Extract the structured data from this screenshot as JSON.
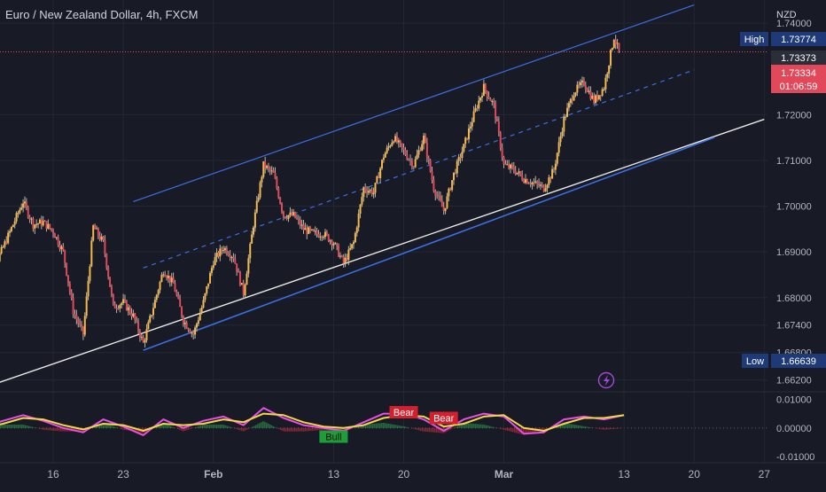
{
  "header": {
    "title": "Euro / New Zealand Dollar, 4h, FXCM"
  },
  "colors": {
    "background": "#181b25",
    "grid": "#232734",
    "candle_up": "#f5b84a",
    "candle_down": "#e1485a",
    "wick": "#b8b3a6",
    "channel": "#3b6fe0",
    "support": "#e8e8e8",
    "price_line": "#e1485a",
    "osc_fast": "#e84fe8",
    "osc_slow": "#f0d64a",
    "hist_up": "#2e9c50",
    "hist_down": "#c4303e",
    "bull": "#1e9d3a",
    "bear": "#d3202f",
    "label_bg": "#1f3a78",
    "accent_icon": "#a04bd6"
  },
  "chart_data": [
    {
      "type": "candlestick",
      "title": "Euro / New Zealand Dollar, 4h, FXCM",
      "y_axis_label": "NZD",
      "ylim": [
        1.6598,
        1.7443
      ],
      "y_ticks": [
        "1.74000",
        "1.72000",
        "1.71000",
        "1.70000",
        "1.69000",
        "1.68000",
        "1.67400",
        "1.66800",
        "1.66200"
      ],
      "x_ticks": [
        "16",
        "23",
        "Feb",
        "13",
        "20",
        "Mar",
        "13",
        "20",
        "27"
      ],
      "price_tags": {
        "high_label": "High",
        "high_value": "1.73774",
        "last_value": "1.73373",
        "current_value": "1.73334",
        "countdown": "01:06:59",
        "low_label": "Low",
        "low_value": "1.66639"
      },
      "channel": {
        "upper": [
          [
            "Jan 24",
            1.701
          ],
          [
            "Mar 20",
            1.744
          ]
        ],
        "middle": [
          [
            "Jan 25",
            1.6865
          ],
          [
            "Mar 20",
            1.7298
          ]
        ],
        "lower": [
          [
            "Jan 25",
            1.6685
          ],
          [
            "Mar 22",
            1.715
          ]
        ]
      },
      "support_line": [
        [
          "Jan 10",
          1.661
        ],
        [
          "Mar 27",
          1.719
        ]
      ],
      "path_points": [
        [
          "Jan 9",
          1.682
        ],
        [
          "Jan 10",
          1.686
        ],
        [
          "Jan 12",
          1.696
        ],
        [
          "Jan 13",
          1.701
        ],
        [
          "Jan 14",
          1.696
        ],
        [
          "Jan 15",
          1.6965
        ],
        [
          "Jan 16",
          1.6945
        ],
        [
          "Jan 17",
          1.69
        ],
        [
          "Jan 18",
          1.677
        ],
        [
          "Jan 19",
          1.672
        ],
        [
          "Jan 20",
          1.6955
        ],
        [
          "Jan 21",
          1.692
        ],
        [
          "Jan 22",
          1.678
        ],
        [
          "Jan 23",
          1.679
        ],
        [
          "Jan 24",
          1.676
        ],
        [
          "Jan 25",
          1.67
        ],
        [
          "Jan 26",
          1.678
        ],
        [
          "Jan 27",
          1.686
        ],
        [
          "Jan 28",
          1.683
        ],
        [
          "Jan 29",
          1.675
        ],
        [
          "Jan 30",
          1.672
        ],
        [
          "Jan 31",
          1.679
        ],
        [
          "Feb 1",
          1.688
        ],
        [
          "Feb 2",
          1.691
        ],
        [
          "Feb 3",
          1.689
        ],
        [
          "Feb 4",
          1.681
        ],
        [
          "Feb 5",
          1.696
        ],
        [
          "Feb 6",
          1.709
        ],
        [
          "Feb 7",
          1.707
        ],
        [
          "Feb 8",
          1.698
        ],
        [
          "Feb 9",
          1.698
        ],
        [
          "Feb 10",
          1.695
        ],
        [
          "Feb 11",
          1.694
        ],
        [
          "Feb 12",
          1.694
        ],
        [
          "Feb 13",
          1.692
        ],
        [
          "Feb 14",
          1.6875
        ],
        [
          "Feb 15",
          1.692
        ],
        [
          "Feb 16",
          1.704
        ],
        [
          "Feb 17",
          1.703
        ],
        [
          "Feb 18",
          1.711
        ],
        [
          "Feb 19",
          1.715
        ],
        [
          "Feb 20",
          1.712
        ],
        [
          "Feb 21",
          1.709
        ],
        [
          "Feb 22",
          1.715
        ],
        [
          "Feb 23",
          1.704
        ],
        [
          "Feb 24",
          1.699
        ],
        [
          "Feb 25",
          1.707
        ],
        [
          "Feb 26",
          1.713
        ],
        [
          "Feb 27",
          1.72
        ],
        [
          "Feb 28",
          1.726
        ],
        [
          "Feb 29",
          1.722
        ],
        [
          "Mar 1",
          1.709
        ],
        [
          "Mar 2",
          1.708
        ],
        [
          "Mar 3",
          1.706
        ],
        [
          "Mar 4",
          1.705
        ],
        [
          "Mar 5",
          1.704
        ],
        [
          "Mar 6",
          1.708
        ],
        [
          "Mar 7",
          1.719
        ],
        [
          "Mar 8",
          1.725
        ],
        [
          "Mar 9",
          1.727
        ],
        [
          "Mar 10",
          1.723
        ],
        [
          "Mar 11",
          1.726
        ],
        [
          "Mar 12",
          1.737
        ],
        [
          "Mar 12.5",
          1.7337
        ]
      ],
      "annotation_icon": "lightning-bolt-icon"
    },
    {
      "type": "line",
      "title": "",
      "y_ticks": [
        "0.01000",
        "0.00000",
        "-0.01000"
      ],
      "ylim": [
        -0.0115,
        0.012
      ],
      "series": [
        {
          "color": "#e84fe8",
          "points": [
            [
              "Jan 9",
              0.0005
            ],
            [
              "Jan 11",
              0.0025
            ],
            [
              "Jan 13",
              0.0045
            ],
            [
              "Jan 15",
              0.0025
            ],
            [
              "Jan 17",
              0.0
            ],
            [
              "Jan 19",
              -0.0015
            ],
            [
              "Jan 21",
              0.003
            ],
            [
              "Jan 23",
              0.0005
            ],
            [
              "Jan 25",
              -0.0025
            ],
            [
              "Jan 27",
              0.003
            ],
            [
              "Jan 29",
              0.0
            ],
            [
              "Jan 31",
              0.0025
            ],
            [
              "Feb 2",
              0.004
            ],
            [
              "Feb 4",
              0.001
            ],
            [
              "Feb 6",
              0.007
            ],
            [
              "Feb 8",
              0.0035
            ],
            [
              "Feb 10",
              0.001
            ],
            [
              "Feb 12",
              0.0
            ],
            [
              "Feb 14",
              -0.001
            ],
            [
              "Feb 16",
              0.002
            ],
            [
              "Feb 18",
              0.005
            ],
            [
              "Feb 20",
              0.005
            ],
            [
              "Feb 22",
              0.003
            ],
            [
              "Feb 24",
              -0.001
            ],
            [
              "Feb 26",
              0.003
            ],
            [
              "Feb 28",
              0.005
            ],
            [
              "Mar 1",
              0.004
            ],
            [
              "Mar 3",
              -0.002
            ],
            [
              "Mar 5",
              -0.0015
            ],
            [
              "Mar 7",
              0.003
            ],
            [
              "Mar 9",
              0.004
            ],
            [
              "Mar 11",
              0.003
            ],
            [
              "Mar 13",
              0.0045
            ]
          ]
        },
        {
          "color": "#f0d64a",
          "points": [
            [
              "Jan 9",
              0.0
            ],
            [
              "Jan 11",
              0.0015
            ],
            [
              "Jan 13",
              0.0035
            ],
            [
              "Jan 15",
              0.003
            ],
            [
              "Jan 17",
              0.001
            ],
            [
              "Jan 19",
              -0.0005
            ],
            [
              "Jan 21",
              0.0015
            ],
            [
              "Jan 23",
              0.001
            ],
            [
              "Jan 25",
              -0.001
            ],
            [
              "Jan 27",
              0.0015
            ],
            [
              "Jan 29",
              0.001
            ],
            [
              "Jan 31",
              0.0015
            ],
            [
              "Feb 2",
              0.003
            ],
            [
              "Feb 4",
              0.002
            ],
            [
              "Feb 6",
              0.005
            ],
            [
              "Feb 8",
              0.0045
            ],
            [
              "Feb 10",
              0.002
            ],
            [
              "Feb 12",
              0.0005
            ],
            [
              "Feb 14",
              0.0
            ],
            [
              "Feb 16",
              0.001
            ],
            [
              "Feb 18",
              0.0035
            ],
            [
              "Feb 20",
              0.0045
            ],
            [
              "Feb 22",
              0.004
            ],
            [
              "Feb 24",
              0.0005
            ],
            [
              "Feb 26",
              0.0015
            ],
            [
              "Feb 28",
              0.004
            ],
            [
              "Mar 1",
              0.0045
            ],
            [
              "Mar 3",
              0.0
            ],
            [
              "Mar 5",
              -0.001
            ],
            [
              "Mar 7",
              0.0015
            ],
            [
              "Mar 9",
              0.0035
            ],
            [
              "Mar 11",
              0.0035
            ],
            [
              "Mar 13",
              0.0045
            ]
          ]
        }
      ],
      "labels": [
        {
          "text": "Bull",
          "date": "Feb 13",
          "value": -0.003,
          "kind": "bull"
        },
        {
          "text": "Bear",
          "date": "Feb 20",
          "value": 0.0055,
          "kind": "bear"
        },
        {
          "text": "Bear",
          "date": "Feb 24",
          "value": 0.0035,
          "kind": "bear"
        }
      ]
    }
  ]
}
